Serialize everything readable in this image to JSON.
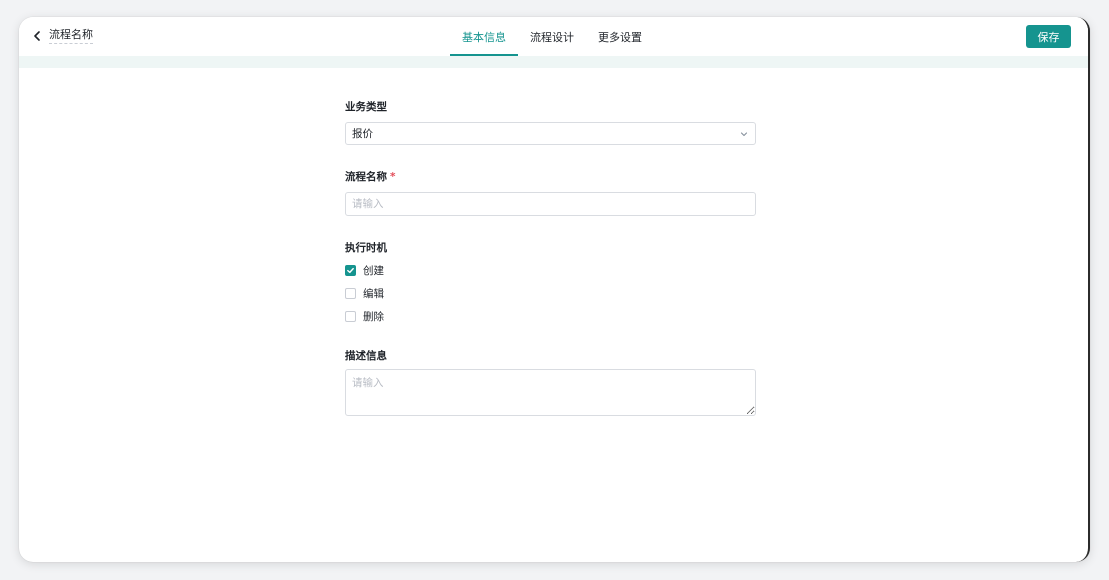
{
  "header": {
    "flow_title": "流程名称",
    "tabs": [
      {
        "label": "基本信息",
        "active": true
      },
      {
        "label": "流程设计",
        "active": false
      },
      {
        "label": "更多设置",
        "active": false
      }
    ],
    "save_label": "保存"
  },
  "form": {
    "business_type": {
      "label": "业务类型",
      "value": "报价"
    },
    "flow_name": {
      "label": "流程名称",
      "required_mark": "*",
      "placeholder": "请输入",
      "value": ""
    },
    "execution_timing": {
      "label": "执行时机",
      "options": [
        {
          "label": "创建",
          "checked": true
        },
        {
          "label": "编辑",
          "checked": false
        },
        {
          "label": "删除",
          "checked": false
        }
      ]
    },
    "description": {
      "label": "描述信息",
      "placeholder": "请输入",
      "value": ""
    }
  },
  "colors": {
    "accent": "#15948f",
    "required": "#e34d59",
    "header_strip": "#eef6f5"
  }
}
